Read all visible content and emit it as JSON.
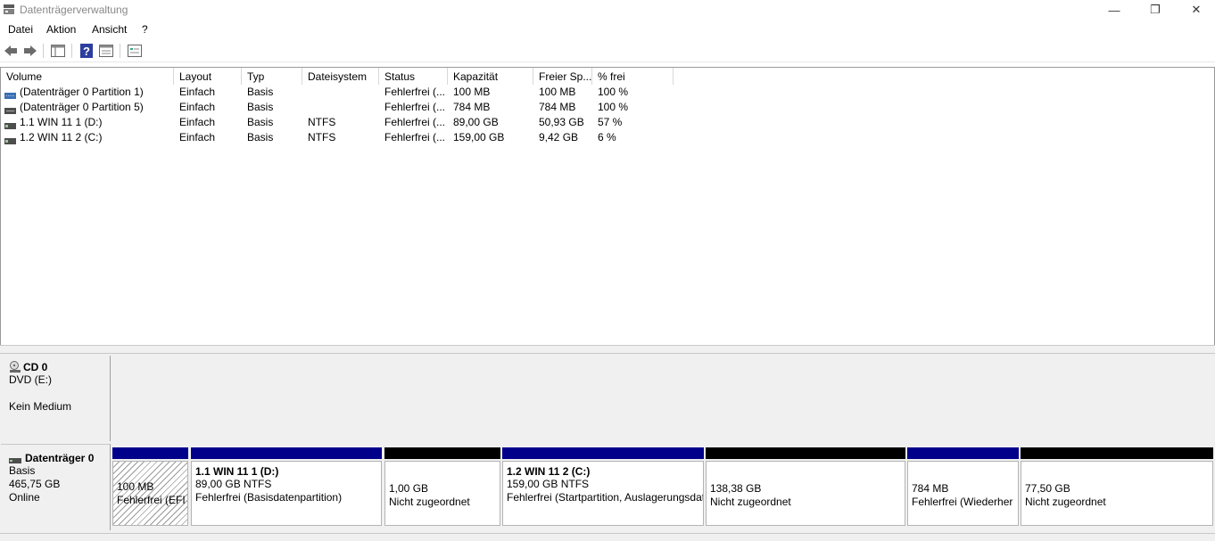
{
  "window": {
    "title": "Datenträgerverwaltung",
    "min_glyph": "—",
    "max_glyph": "❐",
    "close_glyph": "✕"
  },
  "menu": {
    "items": [
      "Datei",
      "Aktion",
      "Ansicht",
      "?"
    ]
  },
  "toolbar": {
    "icons": [
      "back-arrow-icon",
      "forward-arrow-icon",
      "console-tree-icon",
      "help-icon",
      "properties-icon",
      "disk-view-icon"
    ]
  },
  "list": {
    "columns": [
      "Volume",
      "Layout",
      "Typ",
      "Dateisystem",
      "Status",
      "Kapazität",
      "Freier Sp...",
      "% frei"
    ],
    "rows": [
      {
        "volume": "(Datenträger 0 Partition 1)",
        "layout": "Einfach",
        "typ": "Basis",
        "fs": "",
        "status": "Fehlerfrei (...",
        "capacity": "100 MB",
        "free": "100 MB",
        "pct": "100 %"
      },
      {
        "volume": "(Datenträger 0 Partition 5)",
        "layout": "Einfach",
        "typ": "Basis",
        "fs": "",
        "status": "Fehlerfrei (...",
        "capacity": "784 MB",
        "free": "784 MB",
        "pct": "100 %"
      },
      {
        "volume": "1.1 WIN 11 1 (D:)",
        "layout": "Einfach",
        "typ": "Basis",
        "fs": "NTFS",
        "status": "Fehlerfrei (...",
        "capacity": "89,00 GB",
        "free": "50,93 GB",
        "pct": "57 %"
      },
      {
        "volume": "1.2 WIN 11 2 (C:)",
        "layout": "Einfach",
        "typ": "Basis",
        "fs": "NTFS",
        "status": "Fehlerfrei (...",
        "capacity": "159,00 GB",
        "free": "9,42 GB",
        "pct": "6 %"
      }
    ]
  },
  "cd": {
    "title": "CD 0",
    "drive": "DVD (E:)",
    "media": "Kein Medium"
  },
  "disk0": {
    "title": "Datenträger 0",
    "type": "Basis",
    "size": "465,75 GB",
    "state": "Online",
    "partitions": [
      {
        "name": "",
        "line1": "100 MB",
        "line2": "Fehlerfrei (EFI",
        "bar": "#00008b",
        "hatched": true
      },
      {
        "name": "1.1 WIN 11 1  (D:)",
        "line1": "89,00 GB NTFS",
        "line2": "Fehlerfrei (Basisdatenpartition)",
        "bar": "#00008b",
        "hatched": false
      },
      {
        "name": "",
        "line1": "1,00 GB",
        "line2": "Nicht zugeordnet",
        "bar": "#000000",
        "hatched": false
      },
      {
        "name": "1.2 WIN 11 2  (C:)",
        "line1": "159,00 GB NTFS",
        "line2": "Fehlerfrei (Startpartition, Auslagerungsdatei",
        "bar": "#00008b",
        "hatched": false
      },
      {
        "name": "",
        "line1": "138,38 GB",
        "line2": "Nicht zugeordnet",
        "bar": "#000000",
        "hatched": false
      },
      {
        "name": "",
        "line1": "784 MB",
        "line2": "Fehlerfrei (Wiederher",
        "bar": "#00008b",
        "hatched": false
      },
      {
        "name": "",
        "line1": "77,50 GB",
        "line2": "Nicht zugeordnet",
        "bar": "#000000",
        "hatched": false
      }
    ]
  }
}
